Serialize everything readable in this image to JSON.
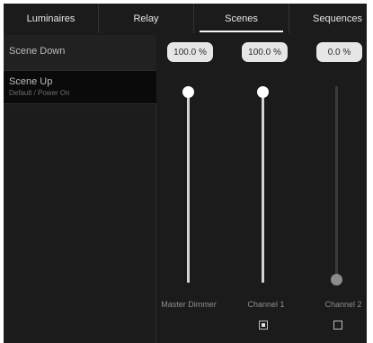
{
  "tabs": [
    {
      "label": "Luminaires",
      "active": false
    },
    {
      "label": "Relay",
      "active": false
    },
    {
      "label": "Scenes",
      "active": true
    },
    {
      "label": "Sequences",
      "active": false
    }
  ],
  "scenes": [
    {
      "name": "Scene Down",
      "subtitle": "",
      "selected": false
    },
    {
      "name": "Scene Up",
      "subtitle": "Default / Power On",
      "selected": true
    }
  ],
  "channels": [
    {
      "value_label": "100.0 %",
      "level": 1.0,
      "label": "Master Dimmer",
      "has_checkbox": false
    },
    {
      "value_label": "100.0 %",
      "level": 1.0,
      "label": "Channel 1",
      "has_checkbox": true,
      "checked": true
    },
    {
      "value_label": "0.0 %",
      "level": 0.0,
      "label": "Channel 2",
      "has_checkbox": true,
      "checked": false
    }
  ],
  "colors": {
    "background": "#1b1b1b",
    "selected_row": "#0a0a0a",
    "thumb_active": "#ffffff",
    "thumb_inactive": "#8c8c8c",
    "value_pill": "#e6e6e6"
  }
}
